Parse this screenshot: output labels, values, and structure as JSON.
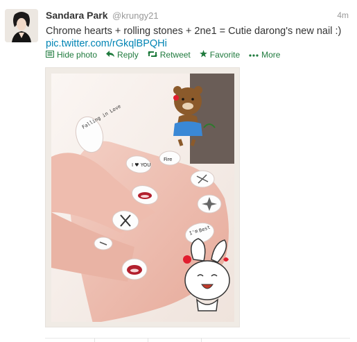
{
  "tweet": {
    "fullname": "Sandara Park",
    "username": "@krungy21",
    "timestamp": "4m",
    "text_before_link": "Chrome hearts + rolling stones + 2ne1 = Cutie darong's new nail :) ",
    "link_text": "pic.twitter.com/rGkqlBPQHi"
  },
  "actions": [
    {
      "label": "Hide photo",
      "icon": "photo-icon"
    },
    {
      "label": "Reply",
      "icon": "reply-icon"
    },
    {
      "label": "Retweet",
      "icon": "retweet-icon"
    },
    {
      "label": "Favorite",
      "icon": "star-icon"
    },
    {
      "label": "More",
      "icon": "more-icon"
    }
  ],
  "photo": {
    "nail_text": [
      "Falling in Love",
      "I ♥ YOU",
      "Fire",
      "Best",
      "I'm"
    ]
  },
  "colors": {
    "action_green": "#1f7a3d",
    "link_blue": "#0084b4",
    "name": "#333333",
    "muted": "#999999"
  }
}
